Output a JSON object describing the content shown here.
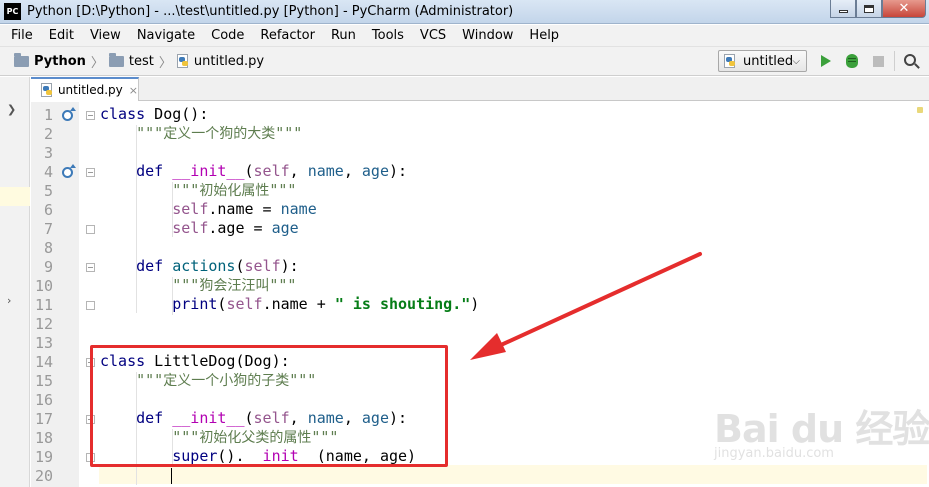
{
  "window": {
    "logo_text": "PC",
    "title": "Python [D:\\Python] - ...\\test\\untitled.py [Python] - PyCharm (Administrator)",
    "close_glyph": "✕"
  },
  "menu": [
    "File",
    "Edit",
    "View",
    "Navigate",
    "Code",
    "Refactor",
    "Run",
    "Tools",
    "VCS",
    "Window",
    "Help"
  ],
  "breadcrumb": {
    "project": "Python",
    "folder": "test",
    "file": "untitled.py",
    "separator": "〉"
  },
  "run_config": {
    "name": "untitled",
    "chevron": "⌵"
  },
  "tab": {
    "label": "untitled.py",
    "close": "×"
  },
  "editor": {
    "line_numbers": [
      "1",
      "2",
      "3",
      "4",
      "5",
      "6",
      "7",
      "8",
      "9",
      "10",
      "11",
      "12",
      "13",
      "14",
      "15",
      "16",
      "17",
      "18",
      "19",
      "20"
    ],
    "code": {
      "l1_kw": "class",
      "l1_name": " Dog",
      "l1_rest": "():",
      "l2_q1": "    \"\"\"",
      "l2_doc": "定义一个狗的大类",
      "l2_q2": "\"\"\"",
      "l4_kw": "    def",
      "l4_sp": " ",
      "l4_fn": "__init__",
      "l4_p1": "(",
      "l4_self": "self",
      "l4_p2": ", ",
      "l4_name": "name",
      "l4_p3": ", ",
      "l4_age": "age",
      "l4_p4": "):",
      "l5_q1": "        \"\"\"",
      "l5_doc": "初始化属性",
      "l5_q2": "\"\"\"",
      "l6_self": "        self",
      "l6_rest": ".name = ",
      "l6_val": "name",
      "l7_self": "        self",
      "l7_rest": ".age = ",
      "l7_val": "age",
      "l9_kw": "    def",
      "l9_fn": " actions",
      "l9_p1": "(",
      "l9_self": "self",
      "l9_p2": "):",
      "l10_q1": "        \"\"\"",
      "l10_doc": "狗会汪汪叫",
      "l10_q2": "\"\"\"",
      "l11_fn": "        print",
      "l11_p1": "(",
      "l11_self": "self",
      "l11_rest": ".name + ",
      "l11_str": "\" is shouting.\"",
      "l11_p2": ")",
      "l14_kw": "class",
      "l14_name": " LittleDog",
      "l14_rest": "(Dog):",
      "l15_q1": "    \"\"\"",
      "l15_doc": "定义一个小狗的子类",
      "l15_q2": "\"\"\"",
      "l17_kw": "    def",
      "l17_sp": " ",
      "l17_fn": "__init__",
      "l17_p1": "(",
      "l17_self": "self",
      "l17_p2": ", ",
      "l17_name": "name",
      "l17_p3": ", ",
      "l17_age": "age",
      "l17_p4": "):",
      "l18_q1": "        \"\"\"",
      "l18_doc": "初始化父类的属性",
      "l18_q2": "\"\"\"",
      "l19_fn": "        super",
      "l19_p1": "().",
      "l19_init": "__init__",
      "l19_p2": "(name, age)"
    }
  },
  "watermark": {
    "brand": "Bai du 经验",
    "url": "jingyan.baidu.com"
  },
  "colors": {
    "keyword": "#000080",
    "self": "#94558d",
    "string": "#067d17",
    "docstring": "#5e7d4f",
    "annotation": "#e52d2d"
  }
}
